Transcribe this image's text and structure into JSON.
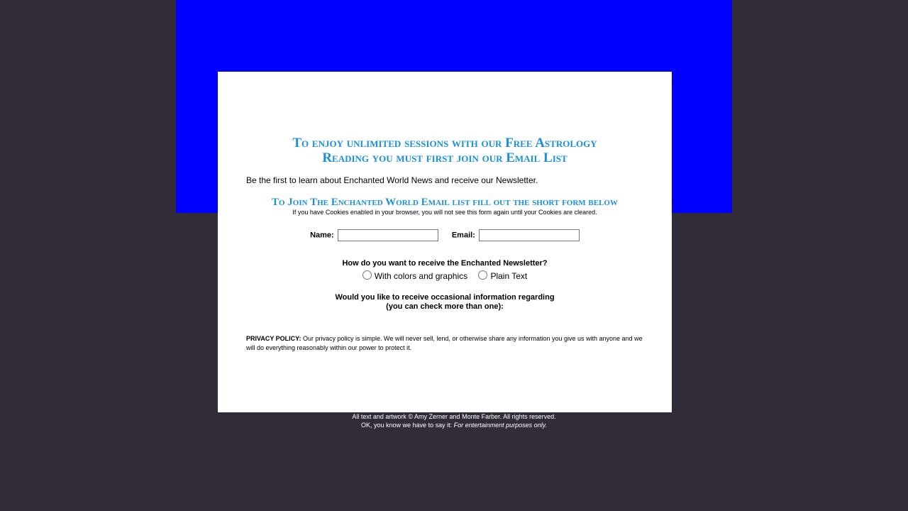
{
  "colors": {
    "page_bg": "#322c38",
    "banner": "#0000ff",
    "panel": "#ffffff",
    "heading": "#1a8fe0"
  },
  "form": {
    "heading_line1": "To enjoy unlimited sessions with our Free Astrology",
    "heading_line2": "Reading you must first join our Email List",
    "intro": "Be the first to learn about Enchanted World News and receive our Newsletter.",
    "subheading": "To Join The Enchanted World Email list fill out the short form below",
    "cookie_note": "If you have Cookies enabled in your browser, you will not see this form again until your Cookies are cleared.",
    "name_label": "Name:",
    "name_value": "",
    "email_label": "Email:",
    "email_value": "",
    "format_question": "How do you want to receive the Enchanted Newsletter?",
    "format_option_1": "With colors and graphics",
    "format_option_2": "Plain Text",
    "info_question_line1": "Would you like to receive occasional information regarding",
    "info_question_line2": "(you can check more than one):",
    "privacy_label": "PRIVACY POLICY:",
    "privacy_text": "Our privacy policy is simple. We will never sell, lend, or otherwise share any information you give us with anyone and we will do everything reasonably within our power to protect it."
  },
  "footer": {
    "line1": "All text and artwork © Amy Zerner and Monte Farber. All rights reserved.",
    "line2_prefix": "OK, you know we have to say it: ",
    "line2_italic": "For entertainment purposes only."
  }
}
